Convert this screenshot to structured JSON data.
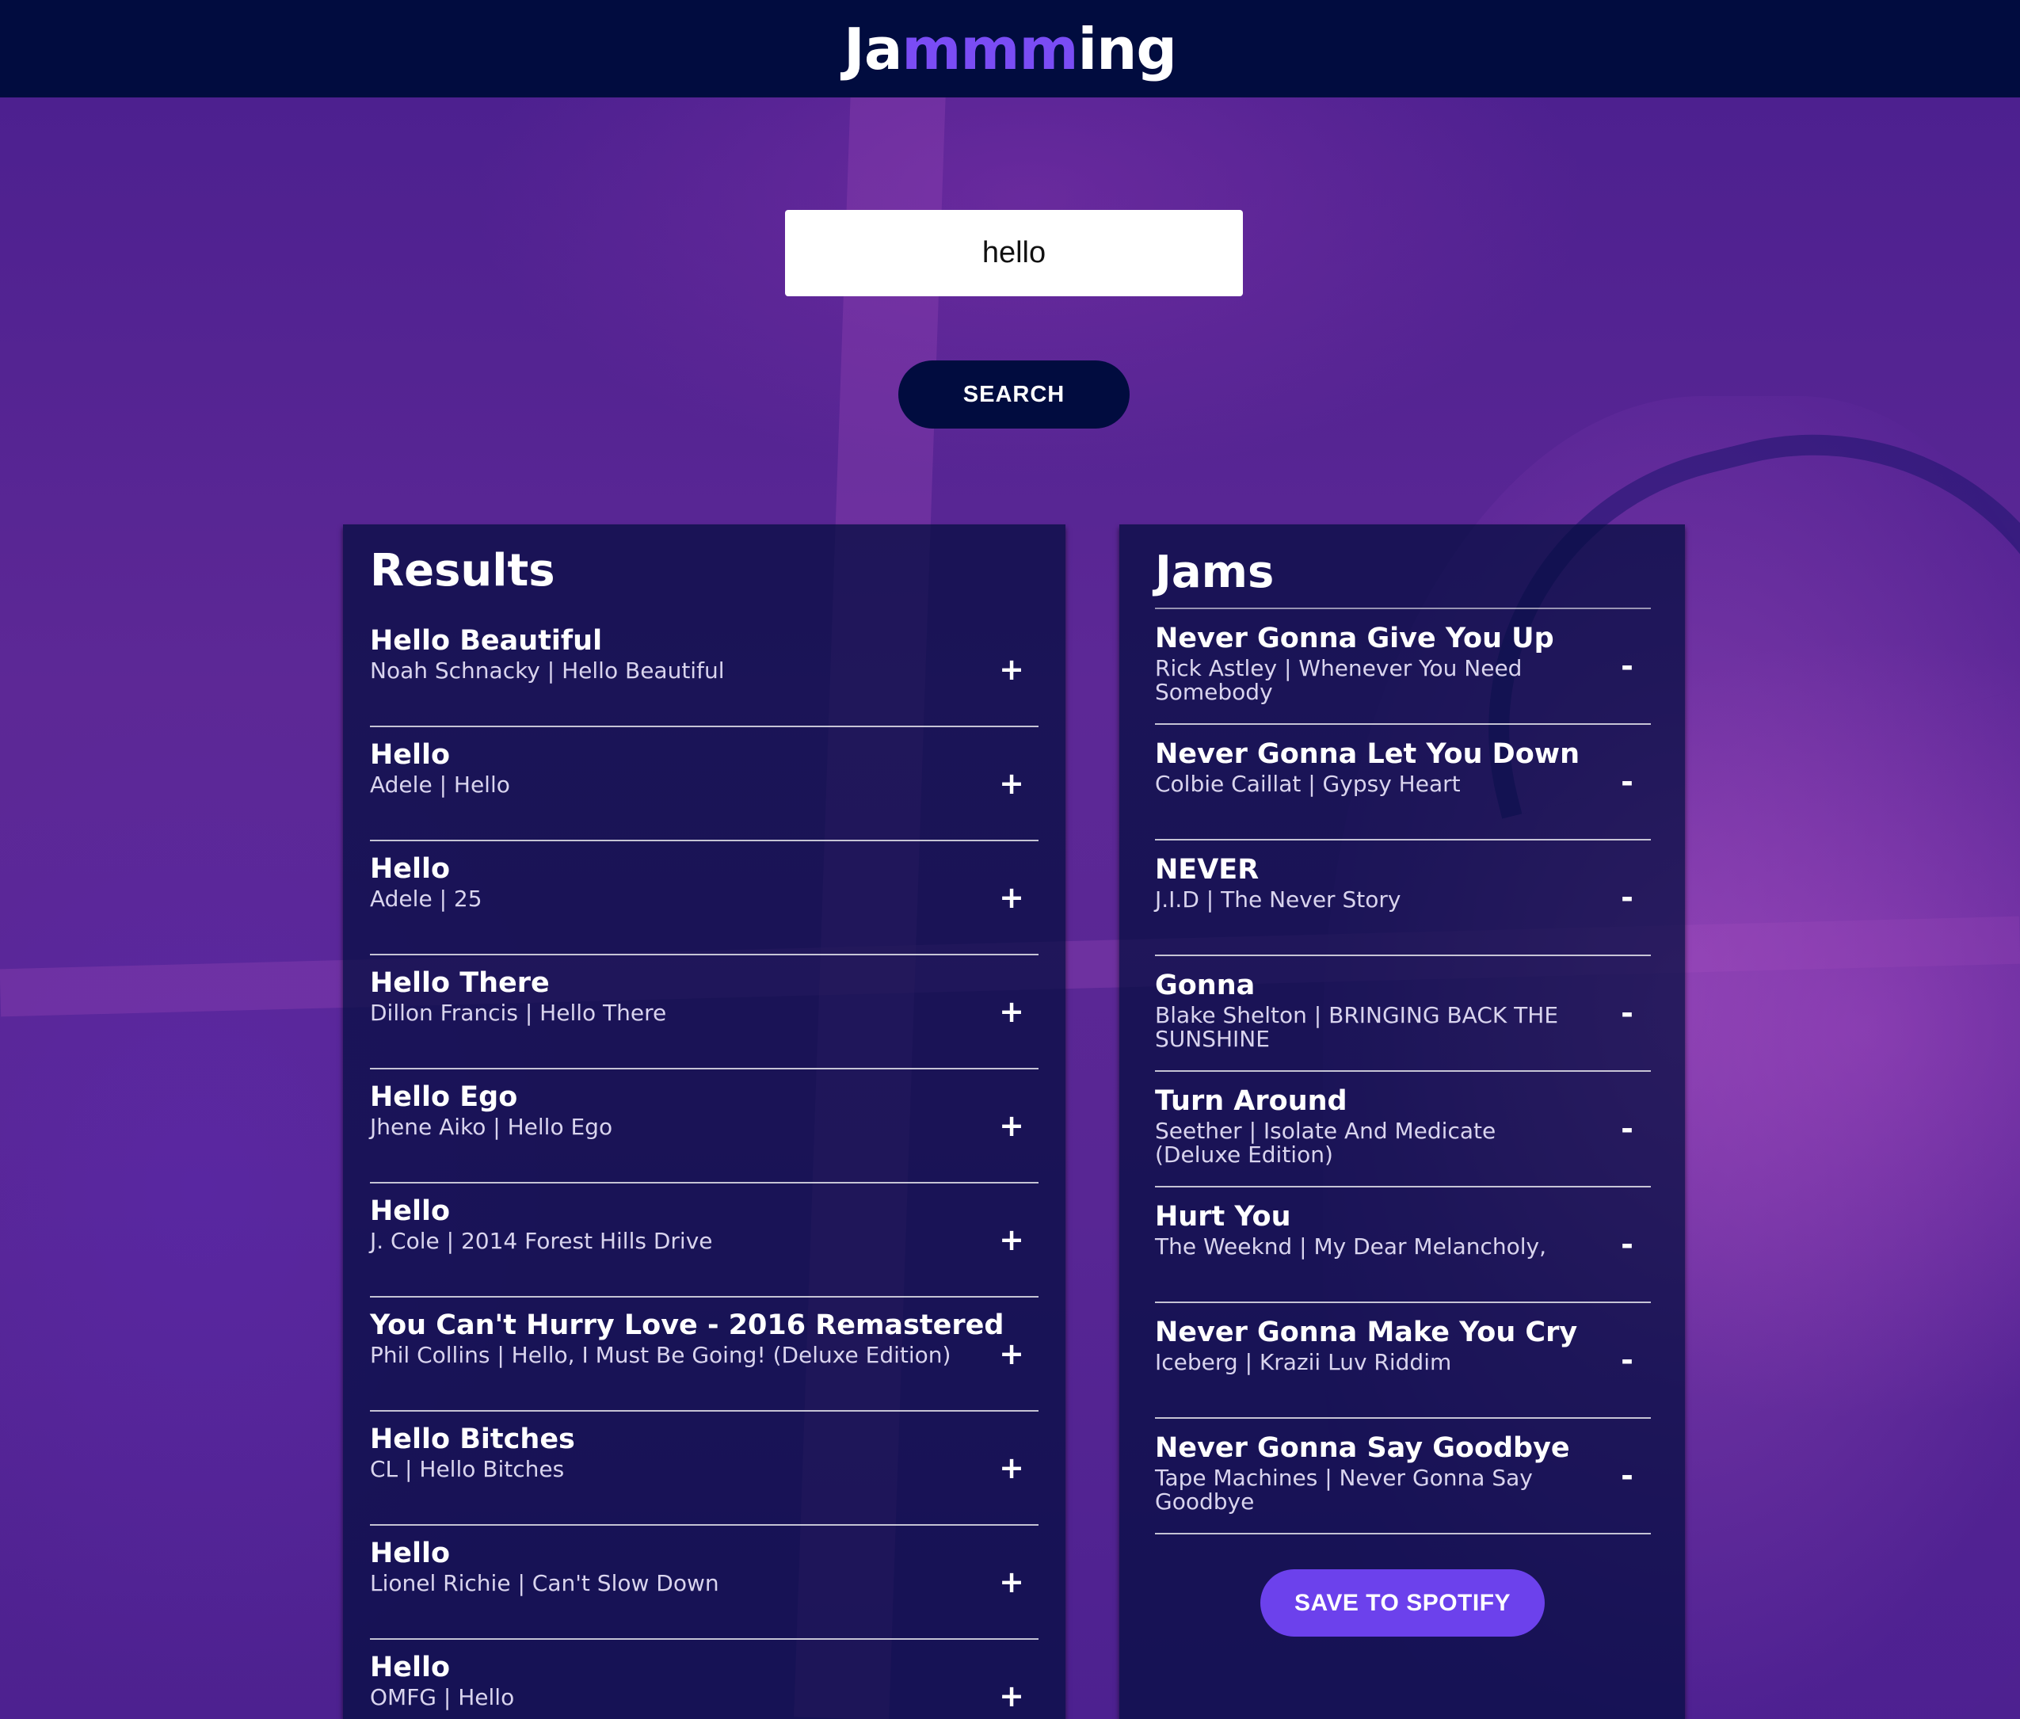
{
  "header": {
    "logo_part1": "Ja",
    "logo_accent": "mmm",
    "logo_part2": "ing",
    "accent_color": "#7a4cf5",
    "background_color": "#010c3f"
  },
  "search": {
    "query": "hello",
    "button_label": "SEARCH"
  },
  "results": {
    "title": "Results",
    "action_symbol": "+",
    "tracks": [
      {
        "name": "Hello Beautiful",
        "meta": "Noah Schnacky | Hello Beautiful"
      },
      {
        "name": "Hello",
        "meta": "Adele | Hello"
      },
      {
        "name": "Hello",
        "meta": "Adele | 25"
      },
      {
        "name": "Hello There",
        "meta": "Dillon Francis | Hello There"
      },
      {
        "name": "Hello Ego",
        "meta": "Jhene Aiko | Hello Ego"
      },
      {
        "name": "Hello",
        "meta": "J. Cole | 2014 Forest Hills Drive"
      },
      {
        "name": "You Can't Hurry Love - 2016 Remastered",
        "meta": "Phil Collins | Hello, I Must Be Going! (Deluxe Edition)"
      },
      {
        "name": "Hello Bitches",
        "meta": "CL | Hello Bitches"
      },
      {
        "name": "Hello",
        "meta": "Lionel Richie | Can't Slow Down"
      },
      {
        "name": "Hello",
        "meta": "OMFG | Hello"
      }
    ]
  },
  "playlist": {
    "title": "Jams",
    "action_symbol": "-",
    "tracks": [
      {
        "name": "Never Gonna Give You Up",
        "meta": "Rick Astley | Whenever You Need Somebody"
      },
      {
        "name": "Never Gonna Let You Down",
        "meta": "Colbie Caillat | Gypsy Heart"
      },
      {
        "name": "NEVER",
        "meta": "J.I.D | The Never Story"
      },
      {
        "name": "Gonna",
        "meta": "Blake Shelton | BRINGING BACK THE SUNSHINE"
      },
      {
        "name": "Turn Around",
        "meta": "Seether | Isolate And Medicate (Deluxe Edition)"
      },
      {
        "name": "Hurt You",
        "meta": "The Weeknd | My Dear Melancholy,"
      },
      {
        "name": "Never Gonna Make You Cry",
        "meta": "Iceberg | Krazii Luv Riddim"
      },
      {
        "name": "Never Gonna Say Goodbye",
        "meta": "Tape Machines | Never Gonna Say Goodbye"
      }
    ],
    "save_label": "SAVE TO SPOTIFY",
    "save_color": "#6c41ec"
  }
}
